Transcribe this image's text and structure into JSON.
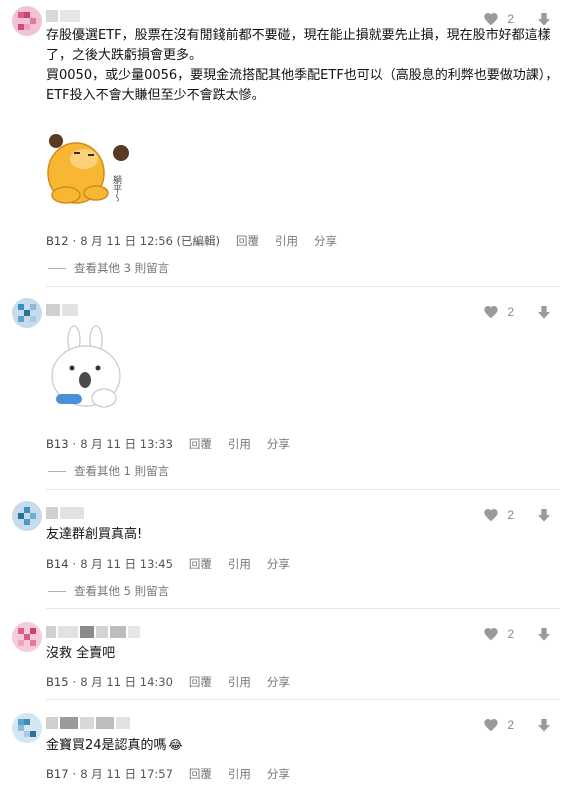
{
  "comments": [
    {
      "floor": "B12",
      "date": "8 月 11 日 12:56 (已編輯)",
      "likes": "2",
      "lines": [
        "存股優選ETF，股票在沒有閒錢前都不要碰，現在能止損就要先止損，現在股市好都這樣",
        "了，之後大跌虧損會更多。",
        "買0050，或少量0056，要現金流搭配其他季配ETF也可以（高股息的利弊也要做功課），",
        "ETF投入不會大賺但至少不會跌太慘。"
      ],
      "sticker_caption": "躺平～",
      "more_replies": "查看其他 3 則留言"
    },
    {
      "floor": "B13",
      "date": "8 月 11 日 13:33",
      "likes": "2",
      "lines": [],
      "more_replies": "查看其他 1 則留言"
    },
    {
      "floor": "B14",
      "date": "8 月 11 日 13:45",
      "likes": "2",
      "lines": [
        "友達群創買真高!"
      ],
      "more_replies": "查看其他 5 則留言"
    },
    {
      "floor": "B15",
      "date": "8 月 11 日 14:30",
      "likes": "2",
      "lines": [
        "沒救 全賣吧"
      ]
    },
    {
      "floor": "B17",
      "date": "8 月 11 日 17:57",
      "likes": "2",
      "lines": [
        "金寶買24是認真的嗎"
      ],
      "emoji": "😂"
    }
  ],
  "actions": {
    "reply": "回覆",
    "quote": "引用",
    "share": "分享",
    "separator": "·"
  },
  "colors": {
    "avatar_pink": "#e05a8a",
    "avatar_blue": "#3a8fc0",
    "icon_gray": "#9a9a9a",
    "divider": "#e8e8e8"
  },
  "icons": [
    "heart-icon",
    "thumb-down-arrow-icon",
    "emoji-laugh-icon"
  ]
}
